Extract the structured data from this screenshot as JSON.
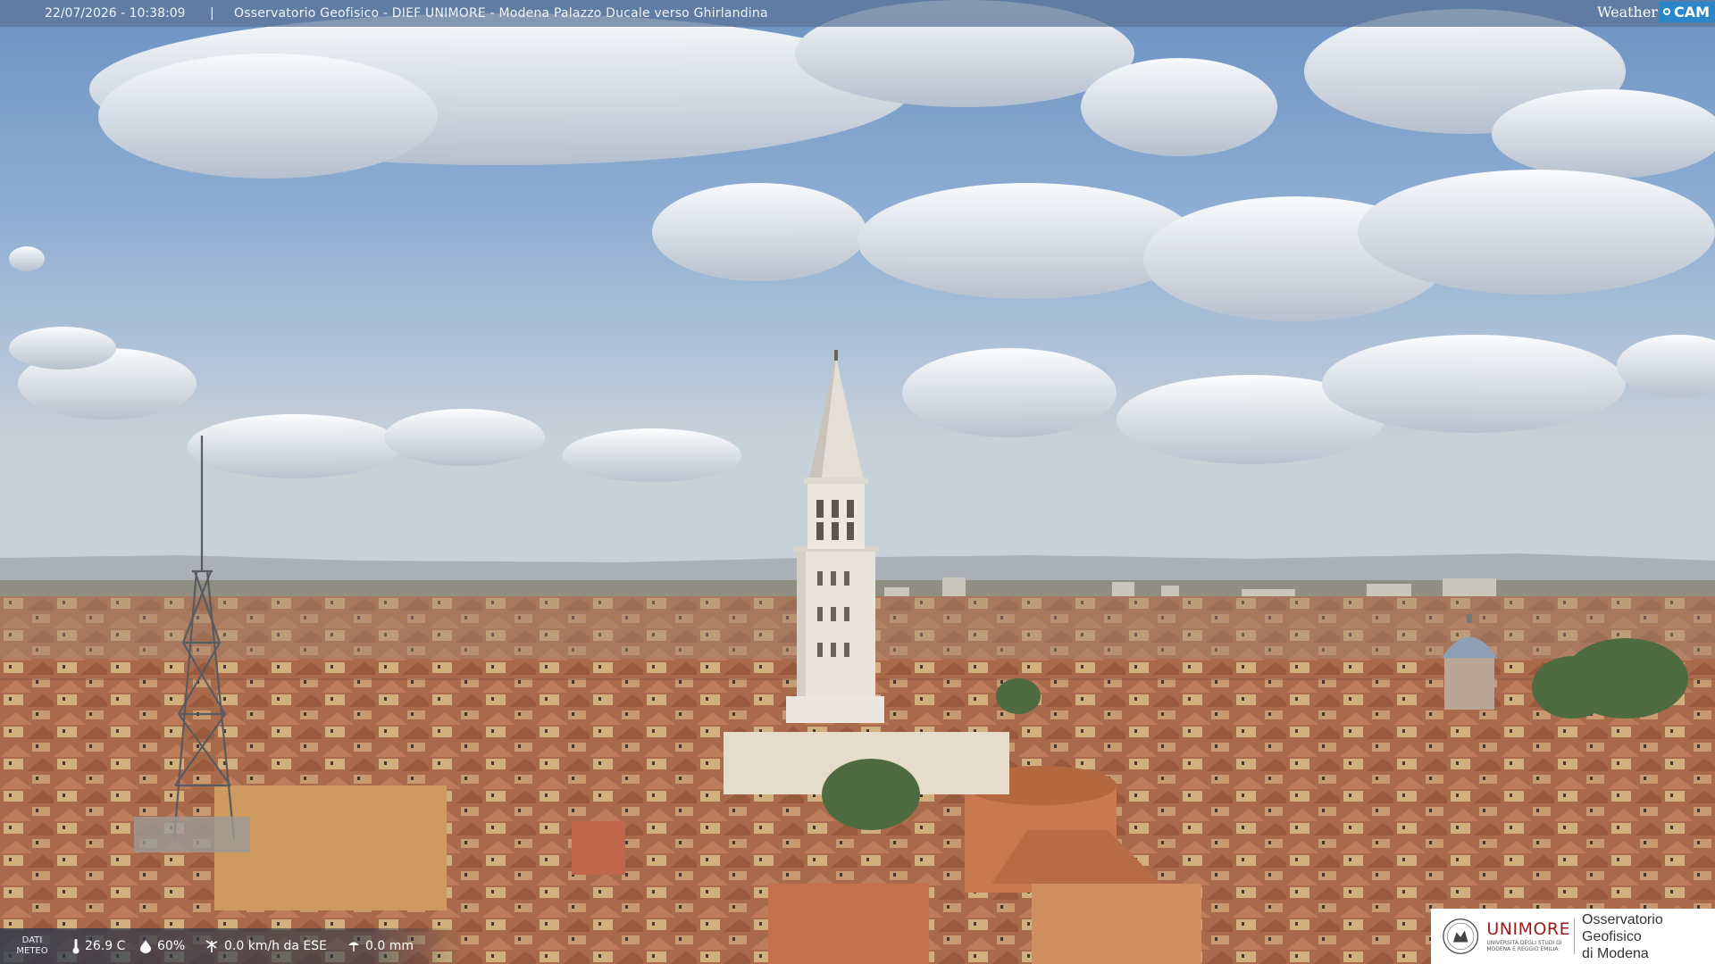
{
  "overlay": {
    "timestamp": "22/07/2026 - 10:38:09",
    "separator": "|",
    "title": "Osservatorio Geofisico - DIEF UNIMORE - Modena Palazzo Ducale verso Ghirlandina",
    "brand_weather": "Weather",
    "brand_cam": "CAM"
  },
  "meteo": {
    "label": "DATI METEO",
    "temperature": "26.9 C",
    "humidity": "60%",
    "wind": "0.0 km/h da ESE",
    "rain": "0.0 mm"
  },
  "logo": {
    "university": "UNIMORE",
    "university_sub": "UNIVERSITÀ DEGLI STUDI DI MODENA E REGGIO EMILIA",
    "observatory_line1": "Osservatorio Geofisico",
    "observatory_line2": "di Modena"
  },
  "colors": {
    "sky_top": "#6e93c2",
    "cloud": "#f4f5f7",
    "roof": "#b06a48",
    "tower": "#e6e2da",
    "unimore_red": "#9b1b1b",
    "weathercam_blue": "#2a86c8"
  },
  "icons": [
    "thermometer-icon",
    "humidity-drop-icon",
    "wind-icon",
    "rain-icon",
    "unimore-seal-icon"
  ]
}
